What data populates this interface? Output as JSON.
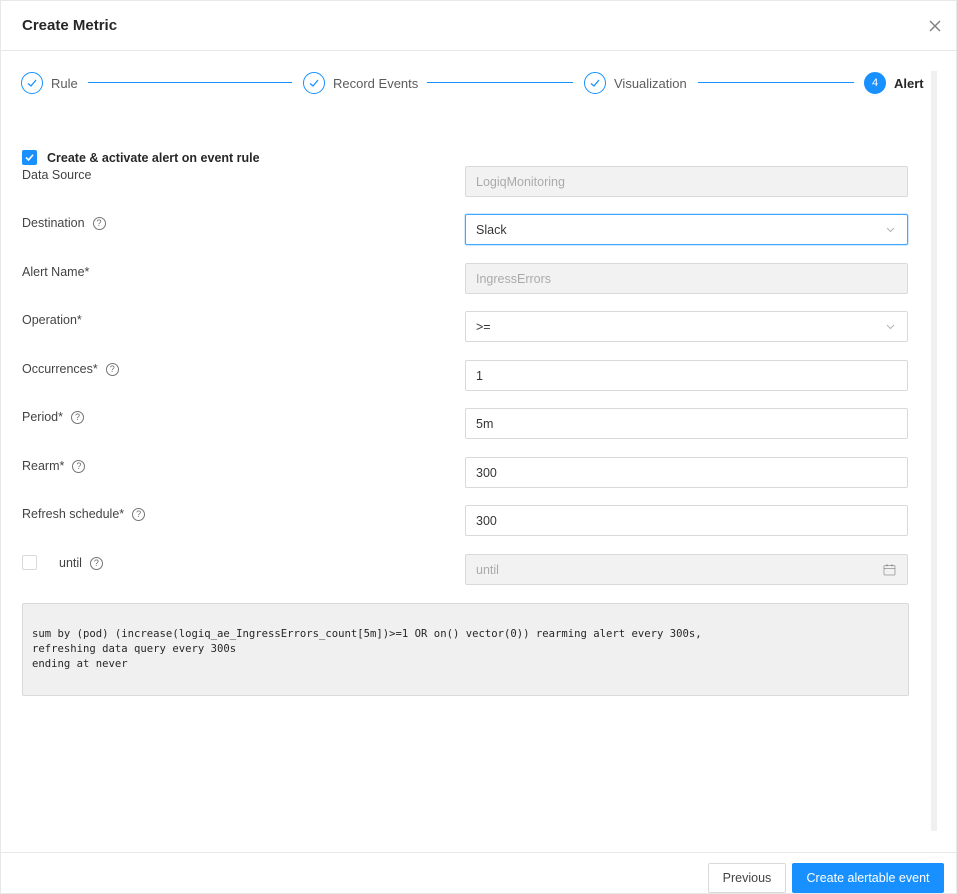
{
  "modal": {
    "title": "Create Metric"
  },
  "steps": [
    {
      "label": "Rule",
      "status": "done"
    },
    {
      "label": "Record Events",
      "status": "done"
    },
    {
      "label": "Visualization",
      "status": "done"
    },
    {
      "label": "Alert",
      "number": "4",
      "status": "active"
    }
  ],
  "form": {
    "activate_checkbox": {
      "label": "Create & activate alert on event rule",
      "checked": true
    },
    "data_source": {
      "label": "Data Source",
      "value": "LogiqMonitoring"
    },
    "destination": {
      "label": "Destination",
      "value": "Slack"
    },
    "alert_name": {
      "label": "Alert Name*",
      "value": "IngressErrors"
    },
    "operation": {
      "label": "Operation*",
      "value": ">="
    },
    "occurrences": {
      "label": "Occurrences*",
      "value": "1"
    },
    "period": {
      "label": "Period*",
      "value": "5m"
    },
    "rearm": {
      "label": "Rearm*",
      "value": "300"
    },
    "refresh_schedule": {
      "label": "Refresh schedule*",
      "value": "300"
    },
    "until": {
      "label": "until",
      "placeholder": "until",
      "checked": false
    }
  },
  "query": {
    "lines": [
      "sum by (pod) (increase(logiq_ae_IngressErrors_count[5m])>=1 OR on() vector(0)) rearming alert every 300s,",
      "refreshing data query every 300s",
      "ending at never"
    ]
  },
  "footer": {
    "previous_label": "Previous",
    "submit_label": "Create alertable event"
  },
  "colors": {
    "accent": "#1890ff"
  }
}
